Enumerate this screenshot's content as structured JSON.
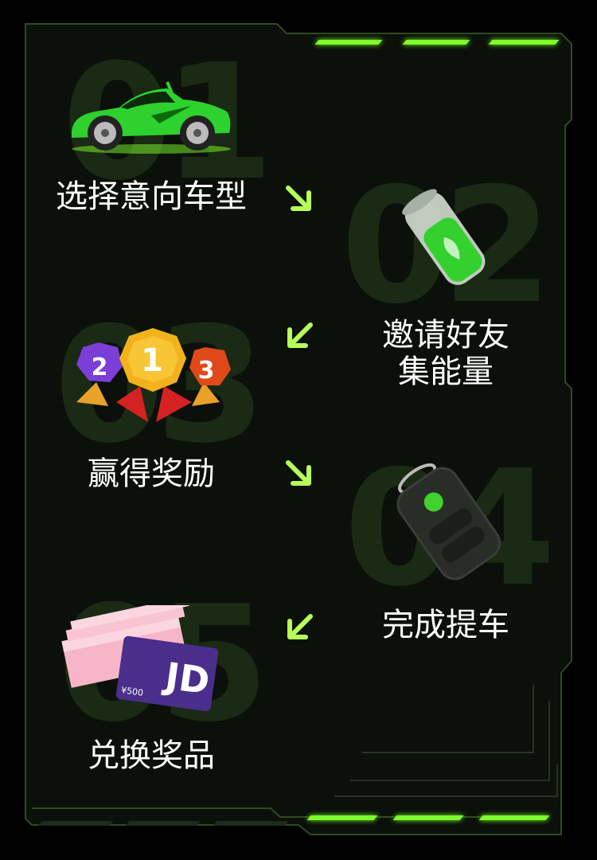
{
  "colors": {
    "background": "#000000",
    "panel": "#0c120b",
    "accent": "#7cff2b",
    "ghost_number": "#1a2a14"
  },
  "steps": [
    {
      "number": "01",
      "label": "选择意向车型",
      "icon": "sports-car-icon"
    },
    {
      "number": "02",
      "label_line1": "邀请好友",
      "label_line2": "集能量",
      "icon": "battery-icon"
    },
    {
      "number": "03",
      "label": "赢得奖励",
      "icon": "medals-icon"
    },
    {
      "number": "04",
      "label": "完成提车",
      "icon": "car-key-icon"
    },
    {
      "number": "05",
      "label": "兑换奖品",
      "icon": "cash-and-card-icon"
    }
  ],
  "medals": [
    "2",
    "1",
    "3"
  ],
  "card": {
    "brand": "JD",
    "value": "¥500"
  }
}
